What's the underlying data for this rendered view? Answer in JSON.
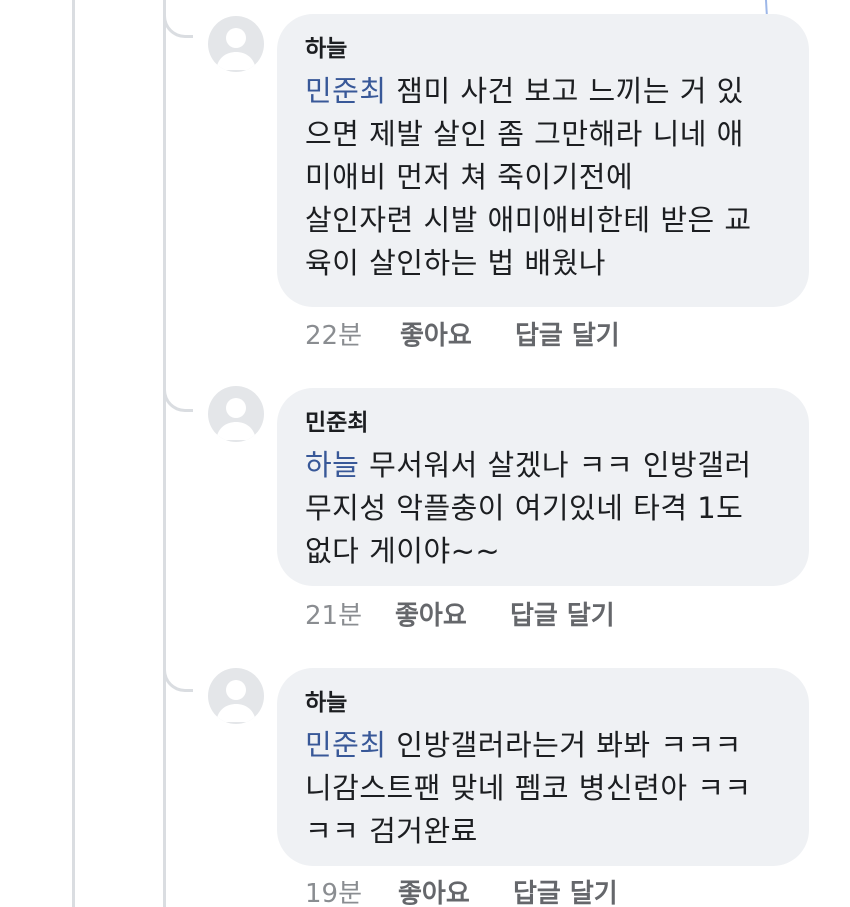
{
  "comments": [
    {
      "author": "하늘",
      "mention": "민준최",
      "lines": [
        " 잼미 사건 보고 느끼는 거 있",
        "으면 제발 살인 좀 그만해라 니네 애",
        "미애비 먼저 쳐 죽이기전에",
        "살인자련 시발 애미애비한테 받은 교",
        "육이 살인하는 법 배웠나"
      ],
      "time": "22분",
      "like_label": "좋아요",
      "reply_label": "답글 달기"
    },
    {
      "author": "민준최",
      "mention": "하늘",
      "lines": [
        " 무서워서 살겠나 ㅋㅋ 인방갤러",
        "무지성 악플충이 여기있네 타격  1도",
        "없다 게이야~~"
      ],
      "time": "21분",
      "like_label": "좋아요",
      "reply_label": "답글 달기"
    },
    {
      "author": "하늘",
      "mention": "민준최",
      "lines": [
        " 인방갤러라는거 봐봐 ㅋㅋㅋ",
        "니감스트팬 맞네 펨코 병신련아 ㅋㅋ",
        "ㅋㅋ 검거완료"
      ],
      "time": "19분",
      "like_label": "좋아요",
      "reply_label": "답글 달기"
    }
  ],
  "colors": {
    "mention": "#385898",
    "bubble": "#eff1f4",
    "thread_line": "#dadde1",
    "meta_text": "#65676b"
  },
  "icons": {
    "avatar": "default-profile-silhouette-icon"
  }
}
